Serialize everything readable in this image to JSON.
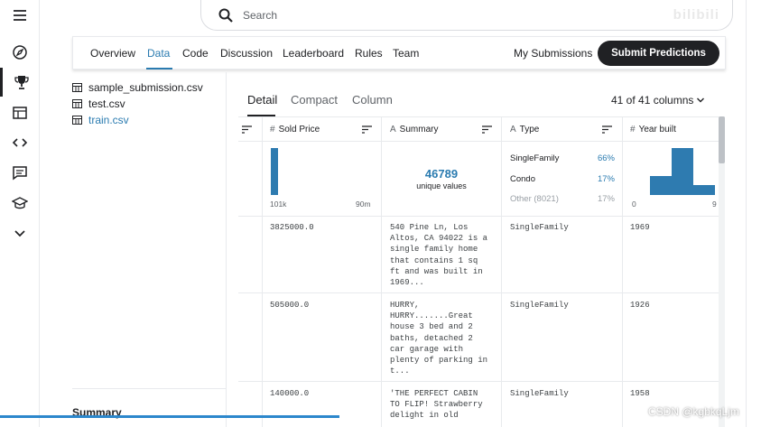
{
  "search": {
    "placeholder": "Search"
  },
  "watermark_text": "bilibili",
  "rail": {
    "items": [
      {
        "icon": "menu-icon"
      },
      {
        "icon": "compass-icon"
      },
      {
        "icon": "trophy-icon",
        "active": true
      },
      {
        "icon": "table-icon"
      },
      {
        "icon": "code-icon"
      },
      {
        "icon": "discussion-icon"
      },
      {
        "icon": "school-icon"
      },
      {
        "icon": "chevron-down-icon"
      }
    ]
  },
  "tabs": [
    "Overview",
    "Data",
    "Code",
    "Discussion",
    "Leaderboard",
    "Rules",
    "Team"
  ],
  "active_tab": "Data",
  "header": {
    "my_submissions": "My Submissions",
    "submit": "Submit Predictions"
  },
  "files": [
    {
      "name": "sample_submission.csv",
      "selected": false
    },
    {
      "name": "test.csv",
      "selected": false
    },
    {
      "name": "train.csv",
      "selected": true
    }
  ],
  "summary_heading": "Summary",
  "view_tabs": [
    "Detail",
    "Compact",
    "Column"
  ],
  "columns_label": "41 of 41 columns",
  "columns": [
    {
      "glyph": "#",
      "name": "Sold Price"
    },
    {
      "glyph": "A",
      "name": "Summary"
    },
    {
      "glyph": "A",
      "name": "Type"
    },
    {
      "glyph": "#",
      "name": "Year built"
    }
  ],
  "sold_price_hist": {
    "min_label": "101k",
    "max_label": "90m",
    "bins": [
      1.0
    ]
  },
  "summary_stat": {
    "count": "46789",
    "label": "unique values"
  },
  "type_dist": [
    {
      "name": "SingleFamily",
      "pct": "66%"
    },
    {
      "name": "Condo",
      "pct": "17%"
    },
    {
      "name": "Other (8021)",
      "pct": "17%"
    }
  ],
  "year_hist": {
    "min_label": "0",
    "max_label": "9",
    "bins": [
      0.4,
      1.0,
      0.22
    ]
  },
  "rows": [
    {
      "sold_price": "3825000.0",
      "summary": "540 Pine Ln, Los\nAltos, CA 94022 is a\nsingle family home\nthat contains 1 sq\nft and was built in\n1969...",
      "type": "SingleFamily",
      "year": "1969"
    },
    {
      "sold_price": "505000.0",
      "summary": "HURRY,\nHURRY.......Great\nhouse 3 bed and 2\nbaths, detached 2\ncar garage with\nplenty of parking in\nt...",
      "type": "SingleFamily",
      "year": "1926"
    },
    {
      "sold_price": "140000.0",
      "summary": "'THE PERFECT CABIN\nTO FLIP! Strawberry\ndelight in old",
      "type": "SingleFamily",
      "year": "1958"
    }
  ],
  "credit": "CSDN @kgbkqLjm",
  "colors": {
    "accent": "#2a7bb0",
    "bar": "#2e7bb0",
    "dark": "#202124"
  }
}
